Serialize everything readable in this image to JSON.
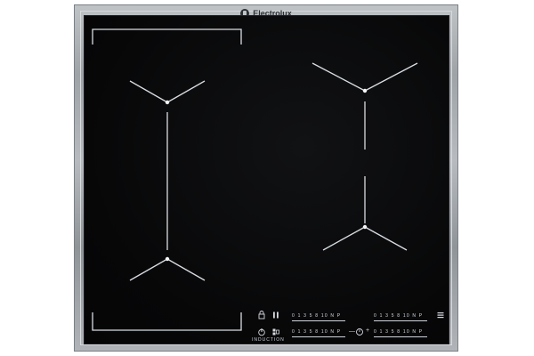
{
  "appliance": {
    "brand": "Electrolux",
    "type_label": "INDUCTION"
  },
  "controls": {
    "power_icon": "power-icon",
    "lock_icon": "lock-icon",
    "pause_icon": "pause-icon",
    "timer_icon": "timer-icon",
    "bridge_icon": "bridge-icon",
    "hob2hood_icon": "hob2hood-icon",
    "left_top_scale": "0 1 3 5 8 10 N P",
    "left_bottom_scale": "0 1 3 5 8 10 N P",
    "right_top_scale": "0 1 3 5 8 10 N P",
    "right_bottom_scale": "0 1 3 5 8 10 N P",
    "timer_minus": "—",
    "timer_plus": "+"
  },
  "colors": {
    "glass": "#070708",
    "frame": "#a9adb1",
    "markings": "#d9dde2"
  }
}
